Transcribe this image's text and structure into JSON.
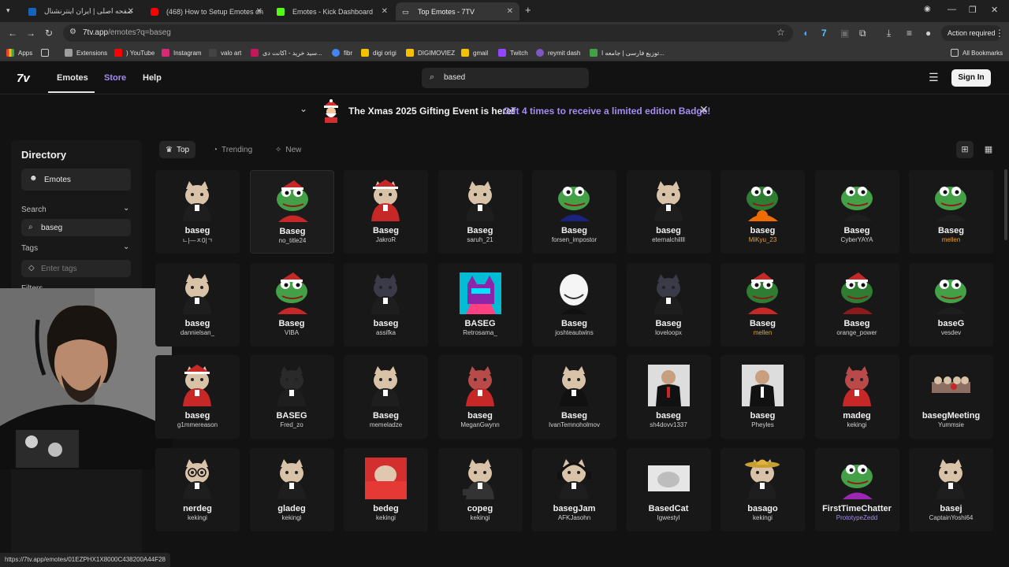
{
  "browser": {
    "tabs": [
      {
        "label": "صفحه اصلی | ایران اینترنشنال",
        "color": "#d32f2f"
      },
      {
        "label": "(468) How to Setup Emotes on",
        "color": "#ff0000"
      },
      {
        "label": "Emotes - Kick Dashboard",
        "color": "#53fc18"
      },
      {
        "label": "Top Emotes - 7TV",
        "color": "#e8e8e8"
      }
    ],
    "new_tab": "+",
    "url_host": "7tv.app",
    "url_path": "/emotes?q=baseg",
    "action_required": "Action required",
    "bookmarks": [
      {
        "label": "Apps",
        "color": "#8f8f8f"
      },
      {
        "label": "Extensions",
        "color": "#9e9e9e"
      },
      {
        "label": ") YouTube",
        "color": "#ff0000"
      },
      {
        "label": "Instagram",
        "color": "#d62976"
      },
      {
        "label": "valo art",
        "color": "#cfcfcf"
      },
      {
        "label": "سید خرید - اکانت دی...",
        "color": "#c2185b"
      },
      {
        "label": "fibr",
        "color": "#4285f4"
      },
      {
        "label": "digi origi",
        "color": "#f2c200"
      },
      {
        "label": "DIGIMOVIEZ",
        "color": "#f2c200"
      },
      {
        "label": "gmail",
        "color": "#f2c200"
      },
      {
        "label": "Twitch",
        "color": "#9146ff"
      },
      {
        "label": "reymit dash",
        "color": "#7e57c2"
      },
      {
        "label": "توزیع فارسی | جامعه ا...",
        "color": "#43a047"
      }
    ],
    "all_bookmarks": "All Bookmarks",
    "status_url": "https://7tv.app/emotes/01EZPHX1X8000C438200A44F28"
  },
  "site": {
    "logo": "7v",
    "nav": {
      "emotes": "Emotes",
      "store": "Store",
      "help": "Help"
    },
    "search_value": "based",
    "sign_in": "Sign In",
    "banner": {
      "text": "The Xmas 2025 Gifting Event is here!",
      "link": "Gift 4 times to receive a limited edition Badge!"
    },
    "accent": "#a48cf0",
    "sidebar": {
      "title": "Directory",
      "emotes": "Emotes",
      "search_label": "Search",
      "search_value": "baseg",
      "tags_label": "Tags",
      "tags_placeholder": "Enter tags",
      "filters_label": "Filters"
    },
    "filters": {
      "top": "Top",
      "trending": "Trending",
      "new": "New"
    },
    "emotes": [
      {
        "name": "baseg",
        "owner": "ㄴ|—ㅈ0|ㄱ",
        "kind": "cat"
      },
      {
        "name": "Baseg",
        "owner": "no_title24",
        "kind": "frog-santa"
      },
      {
        "name": "Baseg",
        "owner": "JakroR",
        "kind": "cat-santa"
      },
      {
        "name": "Baseg",
        "owner": "saruh_21",
        "kind": "cat"
      },
      {
        "name": "Baseg",
        "owner": "forsen_impostor",
        "kind": "frog-suit"
      },
      {
        "name": "baseg",
        "owner": "eternalchillll",
        "kind": "cat"
      },
      {
        "name": "baseg",
        "owner": "MiKyu_23",
        "owner_color": "#e6a23c",
        "kind": "frog-pumpkin"
      },
      {
        "name": "Baseg",
        "owner": "CyberYAYA",
        "kind": "frog"
      },
      {
        "name": "Baseg",
        "owner": "mellen",
        "owner_color": "#e6a23c",
        "kind": "frog"
      },
      {
        "name": "baseg",
        "owner": "dannielsan_",
        "kind": "cat"
      },
      {
        "name": "Baseg",
        "owner": "VIBA",
        "kind": "frog-santa"
      },
      {
        "name": "baseg",
        "owner": "assifka",
        "kind": "cat-dark"
      },
      {
        "name": "BASEG",
        "owner": "Retrosama_",
        "kind": "pink-cat"
      },
      {
        "name": "Baseg",
        "owner": "joshteautwins",
        "kind": "troll"
      },
      {
        "name": "Baseg",
        "owner": "loveloopx",
        "kind": "cat-dark"
      },
      {
        "name": "Baseg",
        "owner": "mellen",
        "owner_color": "#e6a23c",
        "kind": "frog-santa-big"
      },
      {
        "name": "Baseg",
        "owner": "orange_power",
        "kind": "frog-santa-dark"
      },
      {
        "name": "baseG",
        "owner": "vesdev",
        "kind": "frog-side"
      },
      {
        "name": "baseg",
        "owner": "g1mmereason",
        "kind": "cat-santa"
      },
      {
        "name": "BASEG",
        "owner": "Fred_zo",
        "kind": "cat-outline"
      },
      {
        "name": "Baseg",
        "owner": "memeladze",
        "kind": "cat"
      },
      {
        "name": "baseg",
        "owner": "MeganGwynn",
        "kind": "cat-red"
      },
      {
        "name": "Baseg",
        "owner": "IvanTemnoholmov",
        "kind": "cat-suit"
      },
      {
        "name": "baseg",
        "owner": "sh4dovv1337",
        "kind": "man"
      },
      {
        "name": "baseg",
        "owner": "Pheyles",
        "kind": "kid"
      },
      {
        "name": "madeg",
        "owner": "kekingi",
        "kind": "cat-red"
      },
      {
        "name": "basegMeeting",
        "owner": "Yummsie",
        "kind": "meeting"
      },
      {
        "name": "nerdeg",
        "owner": "kekingi",
        "kind": "cat-glasses"
      },
      {
        "name": "gladeg",
        "owner": "kekingi",
        "kind": "cat"
      },
      {
        "name": "bedeg",
        "owner": "kekingi",
        "kind": "cat-bed"
      },
      {
        "name": "copeg",
        "owner": "kekingi",
        "kind": "cat-cope"
      },
      {
        "name": "basegJam",
        "owner": "AFKJasohn",
        "kind": "cat-headphones"
      },
      {
        "name": "BasedCat",
        "owner": "Igwestyl",
        "kind": "cat-white"
      },
      {
        "name": "basago",
        "owner": "kekingi",
        "kind": "cat-sombrero"
      },
      {
        "name": "FirstTimeChatter",
        "owner": "PrototypeZedd",
        "owner_color": "#a48cf0",
        "kind": "frog-chat"
      },
      {
        "name": "basej",
        "owner": "CaptainYoshi64",
        "kind": "cat"
      }
    ]
  }
}
